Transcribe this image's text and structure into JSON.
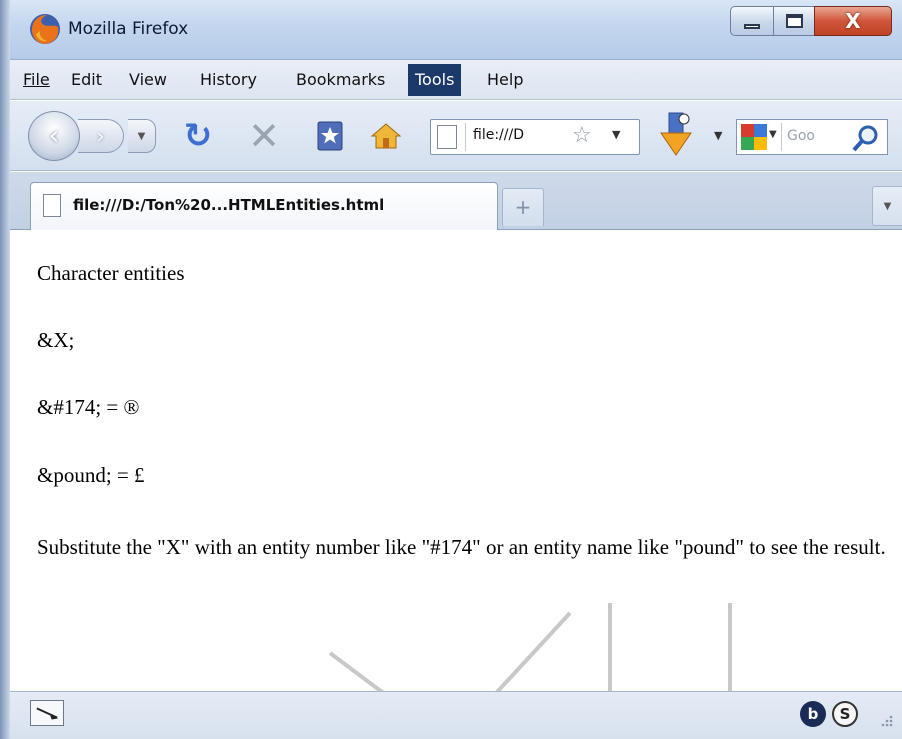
{
  "window": {
    "title": "Mozilla Firefox",
    "close_glyph": "X"
  },
  "menu": {
    "items": [
      {
        "label": "File"
      },
      {
        "label": "Edit"
      },
      {
        "label": "View"
      },
      {
        "label": "History"
      },
      {
        "label": "Bookmarks"
      },
      {
        "label": "Tools"
      },
      {
        "label": "Help"
      }
    ],
    "active": "Tools"
  },
  "navbar": {
    "url_text": "file:///D",
    "search_placeholder": "Goo"
  },
  "tabs": {
    "active_label": "file:///D:/Ton%20...HTMLEntities.html"
  },
  "content": {
    "lines": [
      "Character entities",
      "&X;",
      "&#174; = ®",
      "&pound; = £",
      "Substitute the \"X\" with an entity number like \"#174\" or an entity name like \"pound\" to see the result."
    ]
  },
  "statusbar": {
    "icons": [
      "info-b-icon",
      "s-icon"
    ]
  },
  "watermark": {
    "text": "VU"
  },
  "colors": {
    "menu_active_bg": "#1b3a6a",
    "titlebar": "#c3d6ef",
    "close_button": "#c24325"
  }
}
